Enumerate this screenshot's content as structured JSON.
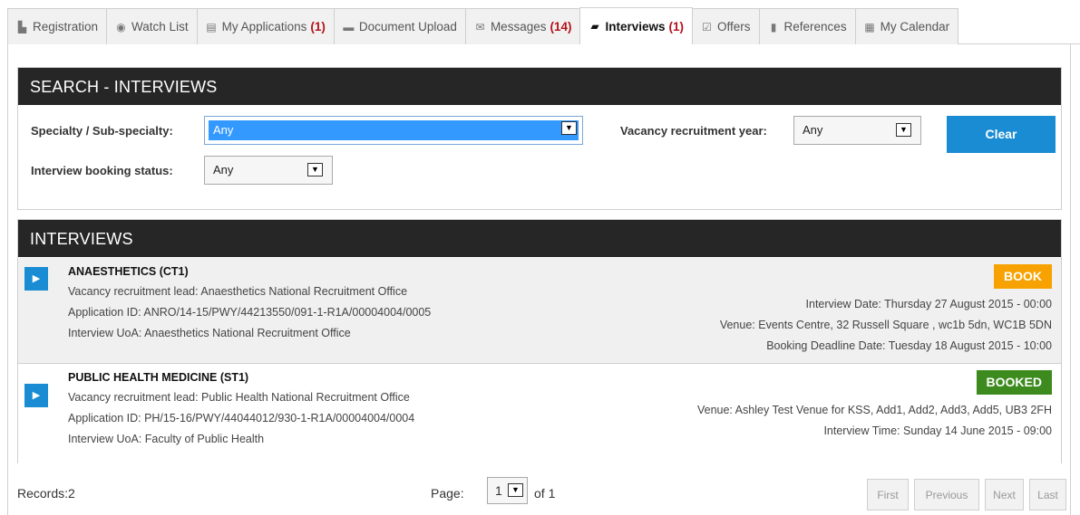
{
  "tabs": [
    {
      "id": "registration",
      "label": "Registration",
      "icon": "building-icon",
      "glyph": "▙",
      "count": ""
    },
    {
      "id": "watch-list",
      "label": "Watch List",
      "icon": "eye-icon",
      "glyph": "◉",
      "count": ""
    },
    {
      "id": "my-applications",
      "label": "My Applications",
      "icon": "document-icon",
      "glyph": "▤",
      "count": "(1)"
    },
    {
      "id": "document-upload",
      "label": "Document Upload",
      "icon": "folder-icon",
      "glyph": "▬",
      "count": ""
    },
    {
      "id": "messages",
      "label": "Messages",
      "icon": "envelope-icon",
      "glyph": "✉",
      "count": "(14)"
    },
    {
      "id": "interviews",
      "label": "Interviews",
      "icon": "briefcase-icon",
      "glyph": "▰",
      "count": "(1)",
      "active": true
    },
    {
      "id": "offers",
      "label": "Offers",
      "icon": "check-square-icon",
      "glyph": "☑",
      "count": ""
    },
    {
      "id": "references",
      "label": "References",
      "icon": "file-icon",
      "glyph": "▮",
      "count": ""
    },
    {
      "id": "my-calendar",
      "label": "My Calendar",
      "icon": "calendar-icon",
      "glyph": "▦",
      "count": ""
    }
  ],
  "search": {
    "title": "SEARCH - INTERVIEWS",
    "specialty_label": "Specialty / Sub-specialty:",
    "specialty_value": "Any",
    "year_label": "Vacancy recruitment year:",
    "year_value": "Any",
    "booking_label": "Interview booking status:",
    "booking_value": "Any",
    "clear_label": "Clear"
  },
  "interviews": {
    "title": "INTERVIEWS",
    "items": [
      {
        "title": "ANAESTHETICS (CT1)",
        "lead": "Vacancy recruitment lead: Anaesthetics National Recruitment Office",
        "application_id": "Application ID: ANRO/14-15/PWY/44213550/091-1-R1A/00004004/0005",
        "uoa": "Interview UoA: Anaesthetics National Recruitment Office",
        "status": "BOOK",
        "status_color": "#f7a200",
        "right_lines": [
          "Interview Date: Thursday 27 August 2015 - 00:00",
          "Venue: Events Centre, 32 Russell Square , wc1b 5dn, WC1B 5DN",
          "Booking Deadline Date: Tuesday 18 August 2015 - 10:00"
        ]
      },
      {
        "title": "PUBLIC HEALTH MEDICINE (ST1)",
        "lead": "Vacancy recruitment lead: Public Health National Recruitment Office",
        "application_id": "Application ID: PH/15-16/PWY/44044012/930-1-R1A/00004004/0004",
        "uoa": "Interview UoA: Faculty of Public Health",
        "status": "BOOKED",
        "status_color": "#3d8b1e",
        "right_lines": [
          "Venue: Ashley Test Venue for KSS, Add1, Add2, Add3, Add5, UB3 2FH",
          "Interview Time: Sunday 14 June 2015 - 09:00"
        ]
      }
    ]
  },
  "footer": {
    "records": "Records:2",
    "page_label": "Page:",
    "page_value": "1",
    "of_label": "of 1",
    "first": "First",
    "previous": "Previous",
    "next": "Next",
    "last": "Last"
  },
  "colors": {
    "accent": "#1a8cd4",
    "header_bg": "#262626",
    "count_red": "#b5121b"
  }
}
